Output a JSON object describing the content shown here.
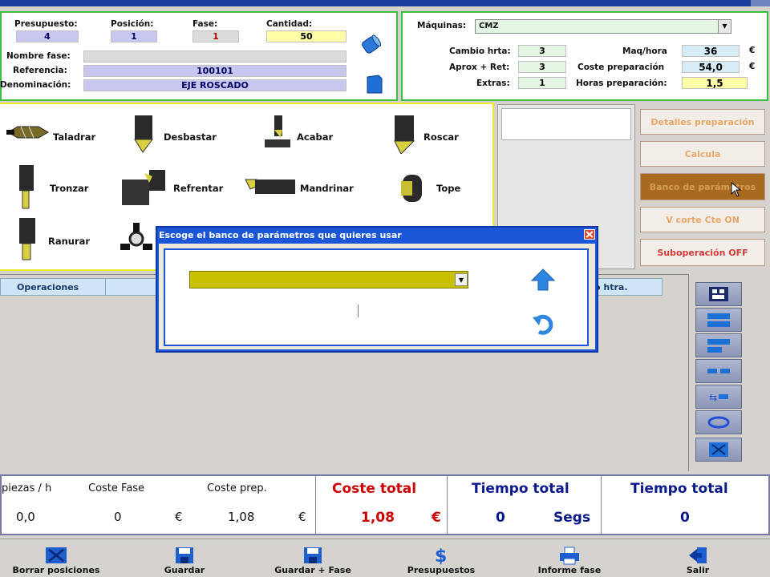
{
  "header": {
    "presupuesto_label": "Presupuesto:",
    "presupuesto_value": "4",
    "posicion_label": "Posición:",
    "posicion_value": "1",
    "fase_label": "Fase:",
    "fase_value": "1",
    "cantidad_label": "Cantidad:",
    "cantidad_value": "50",
    "nombre_fase_label": "Nombre fase:",
    "nombre_fase_value": "",
    "referencia_label": "Referencia:",
    "referencia_value": "100101",
    "denominacion_label": "Denominación:",
    "denominacion_value": "EJE ROSCADO"
  },
  "machine": {
    "maquinas_label": "Máquinas:",
    "maquinas_value": "CMZ",
    "cambio_label": "Cambio hrta:",
    "cambio_value": "3",
    "aprox_label": "Aprox + Ret:",
    "aprox_value": "3",
    "extras_label": "Extras:",
    "extras_value": "1",
    "maqhora_label": "Maq/hora",
    "maqhora_value": "36",
    "coste_prep_label": "Coste preparación",
    "coste_prep_value": "54,0",
    "horas_prep_label": "Horas preparación:",
    "horas_prep_value": "1,5",
    "currency": "€"
  },
  "tools": [
    {
      "label": "Taladrar",
      "icon": "drill-icon"
    },
    {
      "label": "Desbastar",
      "icon": "roughing-tool-icon"
    },
    {
      "label": "Acabar",
      "icon": "finishing-tool-icon"
    },
    {
      "label": "Roscar",
      "icon": "threading-tool-icon"
    },
    {
      "label": "Tronzar",
      "icon": "parting-tool-icon"
    },
    {
      "label": "Refrentar",
      "icon": "facing-tool-icon"
    },
    {
      "label": "Mandrinar",
      "icon": "boring-bar-icon"
    },
    {
      "label": "Tope",
      "icon": "stop-icon"
    },
    {
      "label": "Ranurar",
      "icon": "grooving-tool-icon"
    }
  ],
  "right_buttons": {
    "detalles": "Detalles preparación",
    "calcula": "Calcula",
    "banco": "Banco de parámetros",
    "v_corte": "V corte Cte ON",
    "suboperacion": "Suboperación OFF"
  },
  "table": {
    "col_operaciones": "Operaciones",
    "col_htra": "o htra."
  },
  "dialog": {
    "title": "Escoge el banco de parámetros que quieres usar",
    "select_value": ""
  },
  "totals": {
    "piezas_label": "piezas / h",
    "piezas_value": "0,0",
    "coste_fase_label": "Coste Fase",
    "coste_fase_value": "0",
    "coste_prep_label": "Coste prep.",
    "coste_prep_value": "1,08",
    "coste_total_label": "Coste total",
    "coste_total_value": "1,08",
    "tiempo_total_label": "Tiempo total",
    "tiempo_total_value": "0",
    "tiempo_unit": "Segs",
    "tiempo_total2_label": "Tiempo total",
    "tiempo_total2_value": "0",
    "currency": "€"
  },
  "footer": [
    {
      "label": "Borrar posiciones",
      "icon": "delete-positions-icon"
    },
    {
      "label": "Guardar",
      "icon": "save-icon"
    },
    {
      "label": "Guardar + Fase",
      "icon": "save-phase-icon"
    },
    {
      "label": "Presupuestos",
      "icon": "dollar-icon"
    },
    {
      "label": "Informe fase",
      "icon": "printer-icon"
    },
    {
      "label": "Salir",
      "icon": "exit-icon"
    }
  ],
  "colors": {
    "green_border": "#3fbd3f",
    "yellow_border": "#ecec2a",
    "dialog_title_blue": "#1c56d8",
    "coste_total_red": "#cc0000",
    "tiempo_blue": "#0a1a8c"
  }
}
